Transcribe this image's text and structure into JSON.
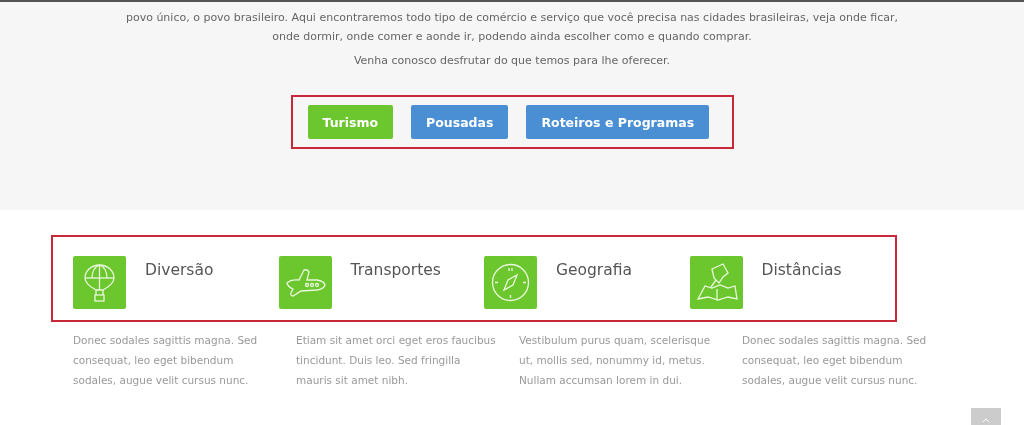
{
  "intro": {
    "lines": [
      "povo único, o povo brasileiro. Aqui encontraremos todo tipo de comércio e serviço que você precisa nas cidades brasileiras, veja onde ficar,",
      "onde dormir, onde comer e aonde ir, podendo ainda escolher como e quando comprar."
    ],
    "invite": "Venha conosco desfrutar do que temos para lhe oferecer."
  },
  "buttons": [
    {
      "label": "Turismo",
      "color": "#6cc62e"
    },
    {
      "label": "Pousadas",
      "color": "#4a8fd4"
    },
    {
      "label": "Roteiros e Programas",
      "color": "#4a8fd4"
    }
  ],
  "features": [
    {
      "kind": "balloon",
      "title": "Diversão",
      "text": "Donec sodales sagittis magna. Sed consequat, leo eget bibendum sodales, augue velit cursus nunc."
    },
    {
      "kind": "plane",
      "title": "Transportes",
      "text": "Etiam sit amet orci eget eros faucibus tincidunt. Duis leo. Sed fringilla mauris sit amet nibh."
    },
    {
      "kind": "compass",
      "title": "Geografia",
      "text": "Vestibulum purus quam, scelerisque ut, mollis sed, nonummy id, metus. Nullam accumsan lorem in dui."
    },
    {
      "kind": "map",
      "title": "Distâncias",
      "text": "Donec sodales sagittis magna. Sed consequat, leo eget bibendum sodales, augue velit cursus nunc."
    }
  ]
}
